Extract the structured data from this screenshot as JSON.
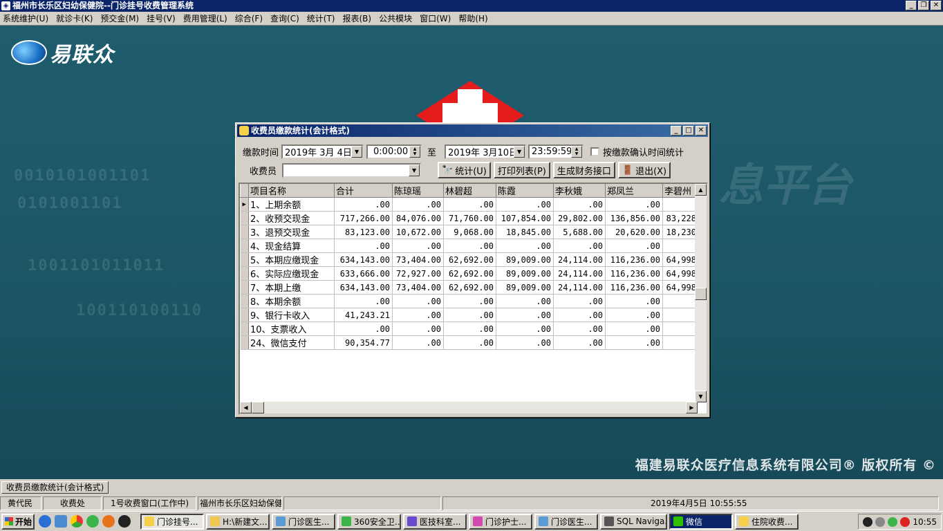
{
  "window": {
    "title": "福州市长乐区妇幼保健院--门诊挂号收费管理系统"
  },
  "menu": [
    "系统维护(U)",
    "就诊卡(K)",
    "预交金(M)",
    "挂号(V)",
    "费用管理(L)",
    "综合(F)",
    "查询(C)",
    "统计(T)",
    "报表(B)",
    "公共模块",
    "窗口(W)",
    "帮助(H)"
  ],
  "desktop": {
    "logo_text": "易联众",
    "copyright": "福建易联众医疗信息系统有限公司® 版权所有 ©"
  },
  "dialog": {
    "title": "收费员缴款统计(会计格式)",
    "pay_time_label": "缴款时间",
    "date_from": "2019年 3月 4日",
    "time_from": "0:00:00",
    "to_label": "至",
    "date_to": "2019年 3月10日",
    "time_to": "23:59:59",
    "checkbox_label": "按缴款确认时间统计",
    "cashier_label": "收费员",
    "cashier_value": "",
    "buttons": {
      "stat": "统计(U)",
      "print": "打印列表(P)",
      "gen": "生成财务接口",
      "exit": "退出(X)"
    },
    "columns": [
      "项目名称",
      "合计",
      "陈琼瑶",
      "林碧超",
      "陈霞",
      "李秋娥",
      "郑凤兰",
      "李碧州"
    ],
    "rows": [
      [
        "1、上期余额",
        ".00",
        ".00",
        ".00",
        ".00",
        ".00",
        ".00",
        ""
      ],
      [
        "2、收预交现金",
        "717,266.00",
        "84,076.00",
        "71,760.00",
        "107,854.00",
        "29,802.00",
        "136,856.00",
        "83,228"
      ],
      [
        "3、退预交现金",
        "83,123.00",
        "10,672.00",
        "9,068.00",
        "18,845.00",
        "5,688.00",
        "20,620.00",
        "18,230"
      ],
      [
        "4、现金结算",
        ".00",
        ".00",
        ".00",
        ".00",
        ".00",
        ".00",
        ""
      ],
      [
        "5、本期应缴现金",
        "634,143.00",
        "73,404.00",
        "62,692.00",
        "89,009.00",
        "24,114.00",
        "116,236.00",
        "64,998"
      ],
      [
        "6、实际应缴现金",
        "633,666.00",
        "72,927.00",
        "62,692.00",
        "89,009.00",
        "24,114.00",
        "116,236.00",
        "64,998"
      ],
      [
        "7、本期上缴",
        "634,143.00",
        "73,404.00",
        "62,692.00",
        "89,009.00",
        "24,114.00",
        "116,236.00",
        "64,998"
      ],
      [
        "8、本期余额",
        ".00",
        ".00",
        ".00",
        ".00",
        ".00",
        ".00",
        ""
      ],
      [
        "9、银行卡收入",
        "41,243.21",
        ".00",
        ".00",
        ".00",
        ".00",
        ".00",
        ""
      ],
      [
        "10、支票收入",
        ".00",
        ".00",
        ".00",
        ".00",
        ".00",
        ".00",
        ""
      ],
      [
        "24、微信支付",
        "90,354.77",
        ".00",
        ".00",
        ".00",
        ".00",
        ".00",
        ""
      ]
    ]
  },
  "status": {
    "tab": "收费员缴款统计(会计格式)",
    "cells": [
      "黄代民",
      "收费处",
      "1号收费窗口(工作中)",
      "福州市长乐区妇幼保健院",
      "",
      "2019年4月5日 10:55:55"
    ]
  },
  "taskbar": {
    "start": "开始",
    "tasks": [
      "门诊挂号...",
      "H:\\新建文...",
      "门诊医生...",
      "360安全卫...",
      "医技科室...",
      "门诊护士...",
      "门诊医生...",
      "SQL Naviga...",
      "微信",
      "住院收费..."
    ],
    "clock": "10:55"
  }
}
